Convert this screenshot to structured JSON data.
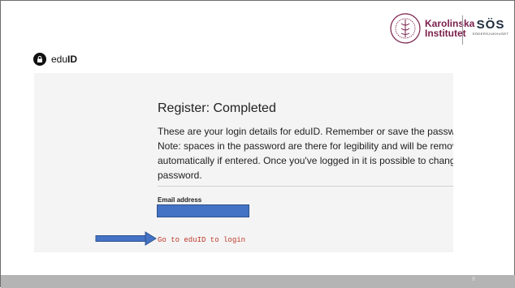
{
  "header": {
    "ki_logo": {
      "line1": "Karolinska",
      "line2": "Institutet"
    },
    "sos_logo": {
      "mark": "SÖS",
      "subtitle": "SÖDERSJUKHUSET"
    }
  },
  "eduid": {
    "logo_text_prefix": "edu",
    "logo_text_bold": "ID"
  },
  "register": {
    "title": "Register: Completed",
    "description_lines": [
      "These are your login details for eduID. Remember or save the password s",
      "Note: spaces in the password are there for legibility and will be removed",
      "automatically if entered. Once you've logged in it is possible to change y",
      "password."
    ],
    "email_label": "Email address",
    "login_link": "Go to eduID to login"
  },
  "footer": {
    "page_number": "8"
  },
  "colors": {
    "accent_red": "#c0392b",
    "redaction_blue": "#4472c4",
    "panel_bg": "#f4f4f4",
    "ki_plum": "#7a1f4b"
  }
}
